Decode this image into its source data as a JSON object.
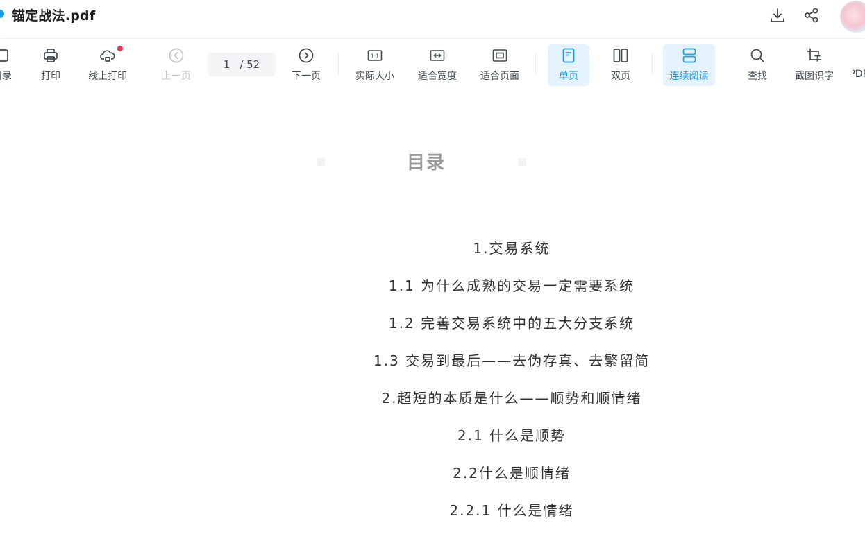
{
  "titlebar": {
    "filename": "锚定战法.pdf"
  },
  "toolbar": {
    "items": [
      {
        "label": "目录"
      },
      {
        "label": "打印"
      },
      {
        "label": "线上打印"
      },
      {
        "label": "上一页"
      },
      {
        "label": "下一页"
      },
      {
        "label": "实际大小"
      },
      {
        "label": "适合宽度"
      },
      {
        "label": "适合页面"
      },
      {
        "label": "单页"
      },
      {
        "label": "双页"
      },
      {
        "label": "连续阅读"
      },
      {
        "label": "查找"
      },
      {
        "label": "截图识字"
      },
      {
        "label": "PDF"
      }
    ],
    "page": {
      "current": "1",
      "total": "/ 52"
    },
    "actual_size_glyph": "1:1"
  },
  "document": {
    "heading": "目录",
    "toc": [
      "1.交易系统",
      "1.1 为什么成熟的交易一定需要系统",
      "1.2 完善交易系统中的五大分支系统",
      "1.3 交易到最后——去伪存真、去繁留简",
      "2.超短的本质是什么——顺势和顺情绪",
      "2.1 什么是顺势",
      "2.2什么是顺情绪",
      "2.2.1 什么是情绪"
    ]
  },
  "colors": {
    "accent": "#1a9be3",
    "active_bg": "#e4f3fd",
    "notification": "#f5365c"
  }
}
